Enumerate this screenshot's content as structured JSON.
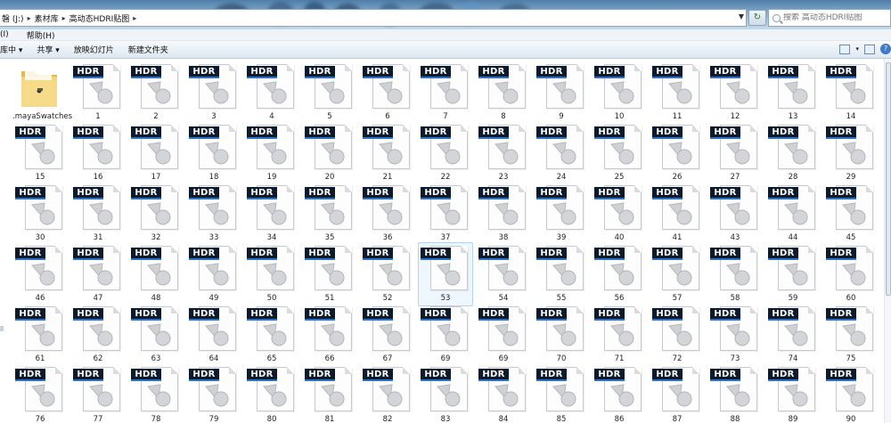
{
  "addressbar": {
    "crumbs": [
      "磐 (J:)",
      "素材库",
      "高动态HDRI贴图"
    ]
  },
  "search": {
    "placeholder": "搜索 高动态HDRI贴图"
  },
  "menu": {
    "items": [
      "(I)",
      "帮助(H)"
    ]
  },
  "toolbar": {
    "items": [
      "库中 ▾",
      "共享 ▾",
      "放映幻灯片",
      "新建文件夹"
    ]
  },
  "icon_tag": "HDR",
  "files": [
    ".mayaSwatches",
    "1",
    "2",
    "3",
    "4",
    "5",
    "6",
    "7",
    "8",
    "9",
    "10",
    "11",
    "12",
    "13",
    "14",
    "15",
    "16",
    "17",
    "18",
    "19",
    "20",
    "21",
    "22",
    "23",
    "24",
    "25",
    "26",
    "27",
    "28",
    "29",
    "30",
    "31",
    "32",
    "33",
    "34",
    "35",
    "36",
    "37",
    "38",
    "39",
    "40",
    "41",
    "43",
    "44",
    "45",
    "46",
    "47",
    "48",
    "49",
    "50",
    "51",
    "52",
    "53",
    "54",
    "55",
    "56",
    "57",
    "58",
    "59",
    "60",
    "61",
    "62",
    "63",
    "64",
    "65",
    "66",
    "67",
    "69",
    "69",
    "70",
    "71",
    "72",
    "73",
    "74",
    "75",
    "76",
    "77",
    "78",
    "79",
    "80",
    "81",
    "82",
    "83",
    "84",
    "85",
    "86",
    "87",
    "88",
    "89",
    "90"
  ],
  "selected_file": "53"
}
